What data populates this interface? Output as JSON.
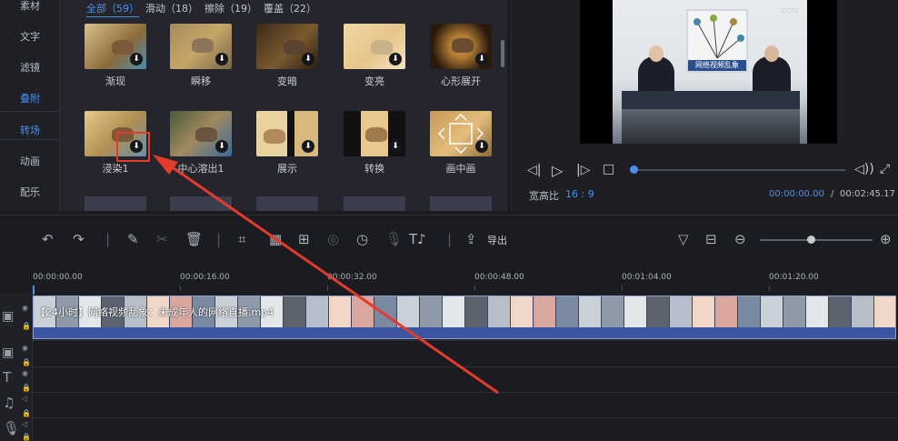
{
  "left_nav": {
    "items": [
      {
        "label": "素材"
      },
      {
        "label": "文字"
      },
      {
        "label": "滤镜"
      },
      {
        "label": "叠附"
      },
      {
        "label": "转场"
      },
      {
        "label": "动画"
      },
      {
        "label": "配乐"
      }
    ]
  },
  "filters": {
    "tabs": [
      {
        "label": "全部（59）",
        "active": true
      },
      {
        "label": "滑动（18）"
      },
      {
        "label": "擦除（19）"
      },
      {
        "label": "覆盖（22）"
      }
    ]
  },
  "transitions": [
    {
      "label": "渐现"
    },
    {
      "label": "瞬移"
    },
    {
      "label": "变暗"
    },
    {
      "label": "变亮"
    },
    {
      "label": "心形展开"
    },
    {
      "label": "浸染1"
    },
    {
      "label": "中心溶出1"
    },
    {
      "label": "展示"
    },
    {
      "label": "转换"
    },
    {
      "label": "画中画"
    }
  ],
  "preview": {
    "aspect_label": "宽高比",
    "aspect_value": "16 : 9",
    "current_time": "00:00:00.00",
    "separator": "/",
    "total_time": "00:02:45.17",
    "progress": 0.0,
    "video_caption": "网络视频乱象",
    "channel_logo": "CCTV"
  },
  "toolbar": {
    "export_label": "导出",
    "zoom_level": 0.45
  },
  "timeline": {
    "ticks": [
      "00:00:00.00",
      "00:00:16.00",
      "00:00:32.00",
      "00:00:48.00",
      "00:01:04.00",
      "00:01:20.00"
    ],
    "clip_name": "【24小时】网络视频乱象：未成年人的网络直播.mp4"
  },
  "colors": {
    "accent": "#4a8ff0",
    "annotation": "#e53b2c",
    "clip_bar": "#3b55a0"
  }
}
